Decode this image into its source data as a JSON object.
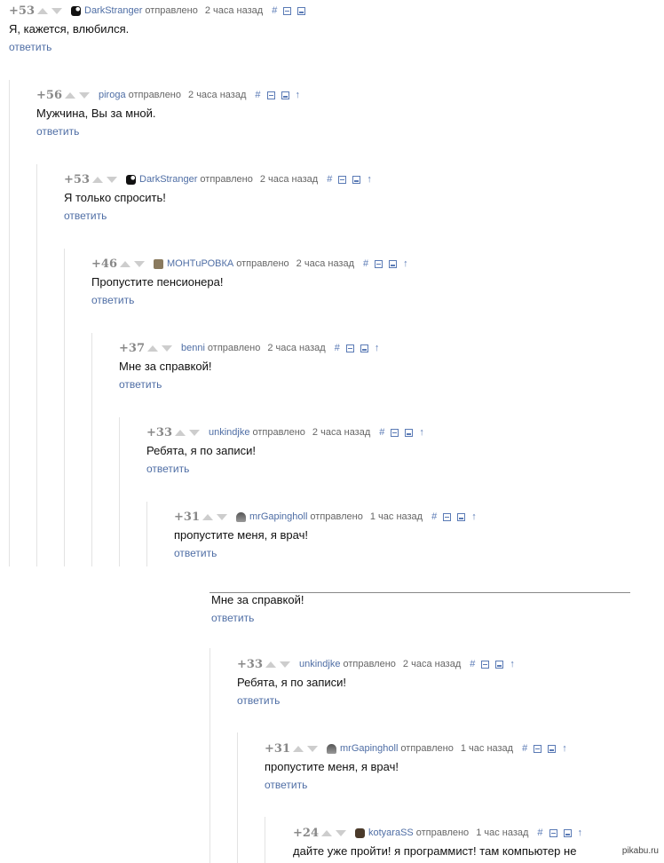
{
  "labels": {
    "sent": "отправлено",
    "reply": "ответить",
    "link": "#",
    "up": "↑"
  },
  "thread1": [
    {
      "rating": "+53",
      "author": "DarkStranger",
      "time": "2 часа назад",
      "text": "Я, кажется, влюбился."
    },
    {
      "rating": "+56",
      "author": "piroga",
      "time": "2 часа назад",
      "text": "Мужчина, Вы за мной."
    },
    {
      "rating": "+53",
      "author": "DarkStranger",
      "time": "2 часа назад",
      "text": "Я только спросить!"
    },
    {
      "rating": "+46",
      "author": "МОНТuРОВКА",
      "time": "2 часа назад",
      "text": "Пропустите пенсионера!"
    },
    {
      "rating": "+37",
      "author": "benni",
      "time": "2 часа назад",
      "text": "Мне за справкой!"
    },
    {
      "rating": "+33",
      "author": "unkindjke",
      "time": "2 часа назад",
      "text": "Ребята, я по записи!"
    },
    {
      "rating": "+31",
      "author": "mrGapingholl",
      "time": "1 час назад",
      "text": "пропустите меня, я врач!"
    }
  ],
  "fragment": {
    "text": "Мне за справкой!",
    "reply": "ответить"
  },
  "thread2": [
    {
      "rating": "+33",
      "author": "unkindjke",
      "time": "2 часа назад",
      "text": "Ребята, я по записи!"
    },
    {
      "rating": "+31",
      "author": "mrGapingholl",
      "time": "1 час назад",
      "text": "пропустите меня, я врач!"
    },
    {
      "rating": "+24",
      "author": "kotyaraSS",
      "time": "1 час назад",
      "text": "дайте уже пройти! я программист! там компьютер не"
    }
  ],
  "watermark": "pikabu.ru"
}
